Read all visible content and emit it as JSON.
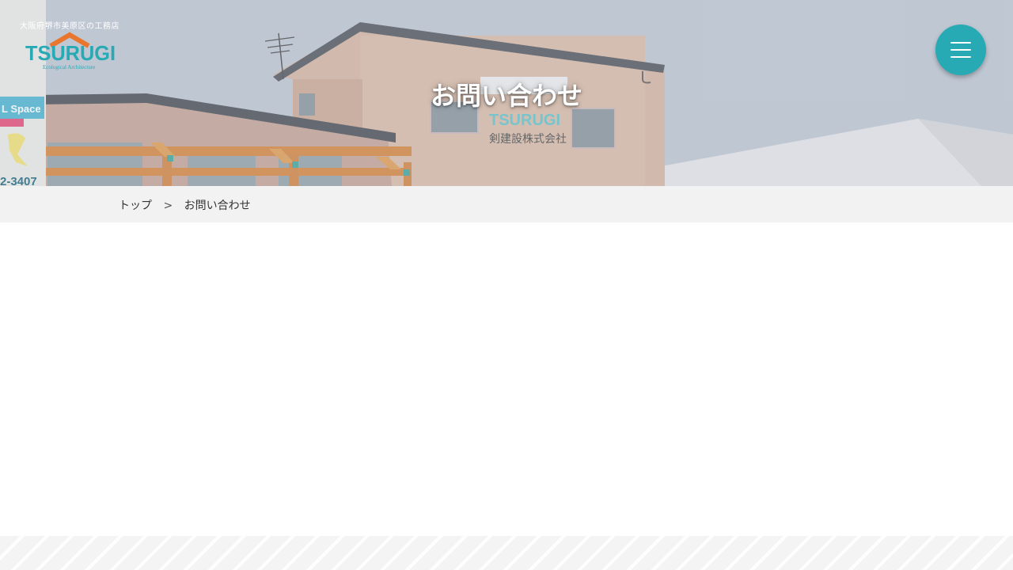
{
  "header": {
    "tagline": "大阪府堺市美原区の工務店",
    "logo": {
      "text": "TSURUGI",
      "subtext": "Ecological Architecture",
      "brand_color": "#27aab4",
      "roof_color": "#e8762c"
    },
    "menu_icon": "hamburger-menu-icon",
    "menu_color": "#27aab4"
  },
  "hero": {
    "title": "お問い合わせ",
    "sign_logo_text": "TSURUGI",
    "sign_company_text": "剣建設株式会社",
    "billboard_text": "L Space",
    "billboard_phone": "2-3407"
  },
  "breadcrumb": {
    "home": "トップ",
    "separator": ">",
    "current": "お問い合わせ"
  }
}
